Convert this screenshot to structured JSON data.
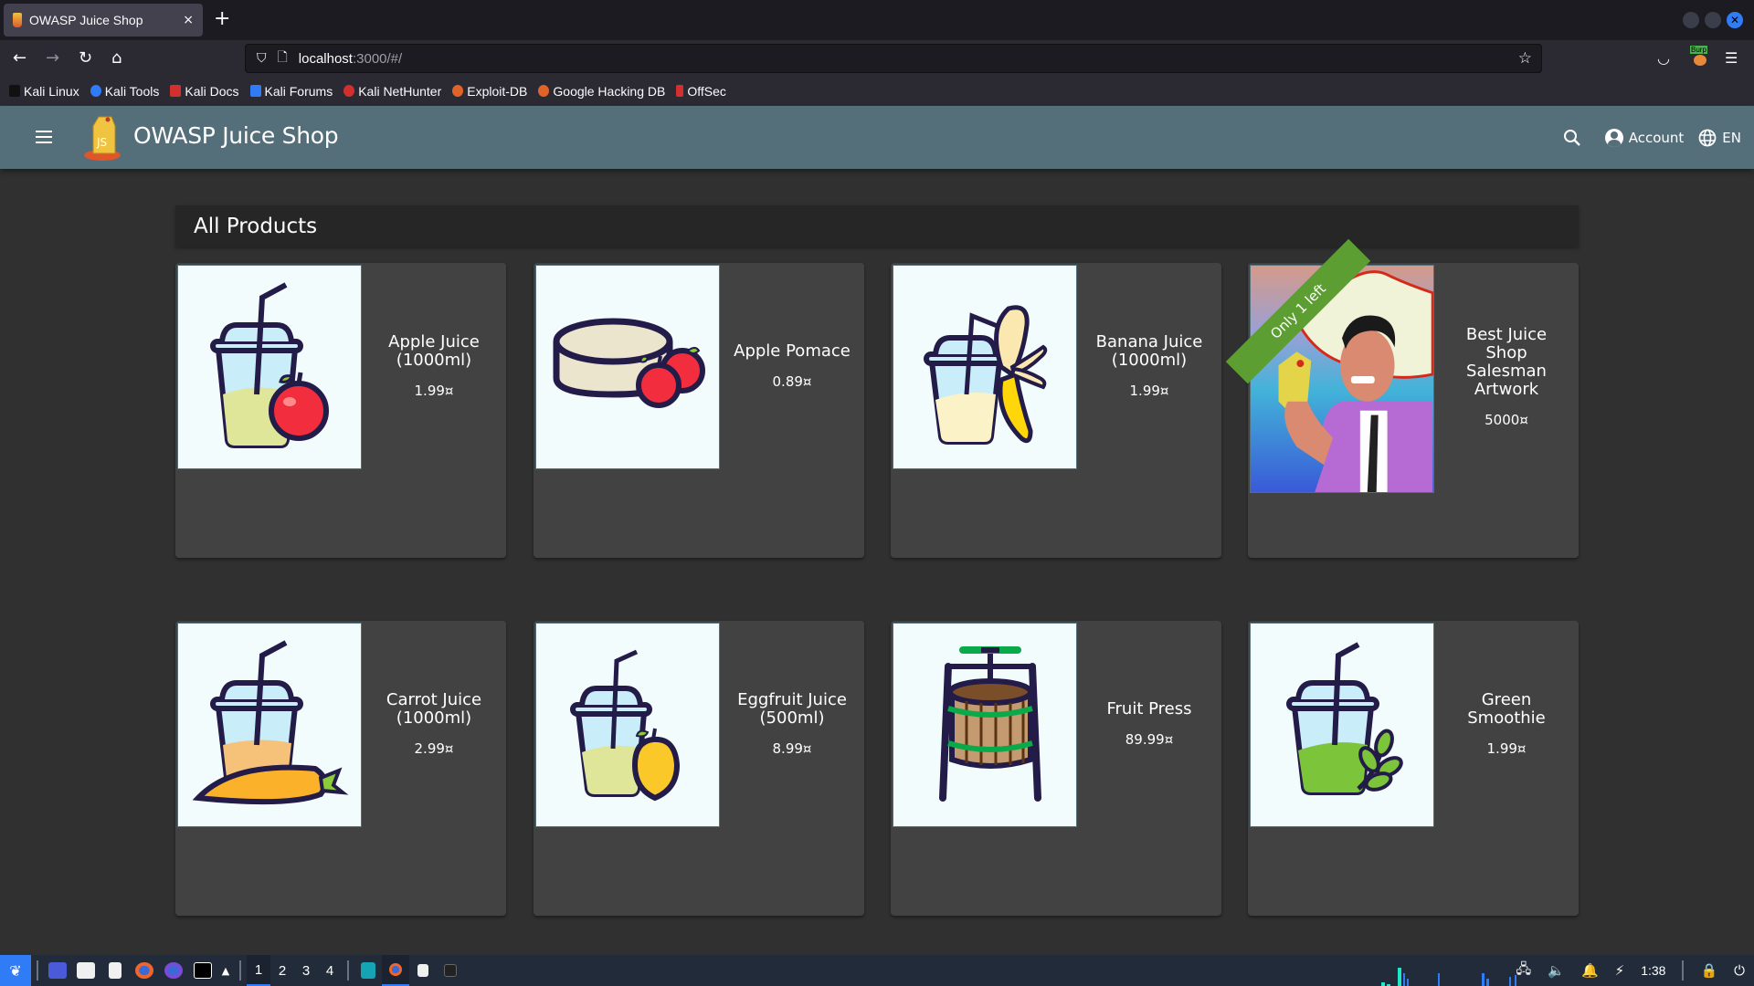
{
  "browser": {
    "tab": {
      "title": "OWASP Juice Shop",
      "close": "×"
    },
    "new_tab": "+",
    "url": {
      "host": "localhost",
      "path": ":3000/#/"
    },
    "bookmarks": [
      {
        "label": "Kali Linux",
        "color": "#111111"
      },
      {
        "label": "Kali Tools",
        "color": "#2f7cf6"
      },
      {
        "label": "Kali Docs",
        "color": "#d32f2f"
      },
      {
        "label": "Kali Forums",
        "color": "#2f7cf6"
      },
      {
        "label": "Kali NetHunter",
        "color": "#d32f2f"
      },
      {
        "label": "Exploit-DB",
        "color": "#e0642a"
      },
      {
        "label": "Google Hacking DB",
        "color": "#e0642a"
      },
      {
        "label": "OffSec",
        "color": "#d32f2f"
      }
    ],
    "extension_badge": "Burp"
  },
  "app": {
    "title": "OWASP Juice Shop",
    "account_label": "Account",
    "language_label": "EN",
    "brand_color": "#546e7a"
  },
  "main": {
    "heading": "All Products",
    "products": [
      {
        "name": "Apple Juice (1000ml)",
        "price": "1.99¤",
        "image": "apple-juice"
      },
      {
        "name": "Apple Pomace",
        "price": "0.89¤",
        "image": "apple-pomace"
      },
      {
        "name": "Banana Juice (1000ml)",
        "price": "1.99¤",
        "image": "banana-juice"
      },
      {
        "name": "Best Juice Shop Salesman Artwork",
        "price": "5000¤",
        "image": "salesman-artwork",
        "ribbon": "Only 1 left"
      },
      {
        "name": "Carrot Juice (1000ml)",
        "price": "2.99¤",
        "image": "carrot-juice"
      },
      {
        "name": "Eggfruit Juice (500ml)",
        "price": "8.99¤",
        "image": "eggfruit-juice"
      },
      {
        "name": "Fruit Press",
        "price": "89.99¤",
        "image": "fruit-press"
      },
      {
        "name": "Green Smoothie",
        "price": "1.99¤",
        "image": "green-smoothie"
      }
    ]
  },
  "taskbar": {
    "workspaces": [
      "1",
      "2",
      "3",
      "4"
    ],
    "active_workspace": "1",
    "clock": "1:38"
  }
}
